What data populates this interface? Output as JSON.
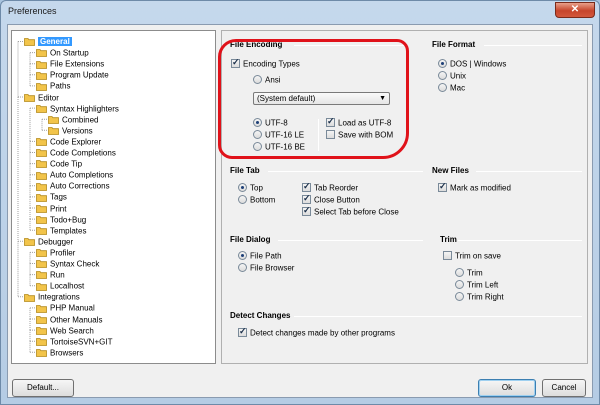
{
  "window": {
    "title": "Preferences",
    "close_glyph": "✕"
  },
  "tree": {
    "items": [
      {
        "label": "General",
        "level": 0,
        "selected": true
      },
      {
        "label": "On Startup",
        "level": 1
      },
      {
        "label": "File Extensions",
        "level": 1
      },
      {
        "label": "Program Update",
        "level": 1
      },
      {
        "label": "Paths",
        "level": 1
      },
      {
        "label": "Editor",
        "level": 0
      },
      {
        "label": "Syntax Highlighters",
        "level": 1
      },
      {
        "label": "Combined",
        "level": 2
      },
      {
        "label": "Versions",
        "level": 2
      },
      {
        "label": "Code Explorer",
        "level": 1
      },
      {
        "label": "Code Completions",
        "level": 1
      },
      {
        "label": "Code Tip",
        "level": 1
      },
      {
        "label": "Auto Completions",
        "level": 1
      },
      {
        "label": "Auto Corrections",
        "level": 1
      },
      {
        "label": "Tags",
        "level": 1
      },
      {
        "label": "Print",
        "level": 1
      },
      {
        "label": "Todo+Bug",
        "level": 1
      },
      {
        "label": "Templates",
        "level": 1
      },
      {
        "label": "Debugger",
        "level": 0
      },
      {
        "label": "Profiler",
        "level": 1
      },
      {
        "label": "Syntax Check",
        "level": 1
      },
      {
        "label": "Run",
        "level": 1
      },
      {
        "label": "Localhost",
        "level": 1
      },
      {
        "label": "Integrations",
        "level": 0
      },
      {
        "label": "PHP Manual",
        "level": 1
      },
      {
        "label": "Other Manuals",
        "level": 1
      },
      {
        "label": "Web Search",
        "level": 1
      },
      {
        "label": "TortoiseSVN+GIT",
        "level": 1
      },
      {
        "label": "Browsers",
        "level": 1
      }
    ]
  },
  "file_encoding": {
    "title": "File Encoding",
    "encoding_types": {
      "label": "Encoding Types",
      "checked": true
    },
    "ansi": {
      "label": "Ansi",
      "checked": false
    },
    "dropdown_value": "(System default)",
    "utf8": {
      "label": "UTF-8",
      "checked": true
    },
    "utf16le": {
      "label": "UTF-16 LE",
      "checked": false
    },
    "utf16be": {
      "label": "UTF-16 BE",
      "checked": false
    },
    "load_as_utf8": {
      "label": "Load as UTF-8",
      "checked": true
    },
    "save_with_bom": {
      "label": "Save with BOM",
      "checked": false
    }
  },
  "file_format": {
    "title": "File Format",
    "dos": {
      "label": "DOS | Windows",
      "checked": true
    },
    "unix": {
      "label": "Unix",
      "checked": false
    },
    "mac": {
      "label": "Mac",
      "checked": false
    }
  },
  "file_tab": {
    "title": "File Tab",
    "top": {
      "label": "Top",
      "checked": true
    },
    "bottom": {
      "label": "Bottom",
      "checked": false
    },
    "tab_reorder": {
      "label": "Tab Reorder",
      "checked": true
    },
    "close_button": {
      "label": "Close Button",
      "checked": true
    },
    "select_tab": {
      "label": "Select Tab before Close",
      "checked": true
    }
  },
  "new_files": {
    "title": "New Files",
    "mark_modified": {
      "label": "Mark as modified",
      "checked": true
    }
  },
  "file_dialog": {
    "title": "File Dialog",
    "file_path": {
      "label": "File Path",
      "checked": true
    },
    "file_browser": {
      "label": "File Browser",
      "checked": false
    }
  },
  "trim": {
    "title": "Trim",
    "trim_on_save": {
      "label": "Trim on save",
      "checked": false
    },
    "trim_opt": {
      "label": "Trim",
      "checked": false
    },
    "trim_left": {
      "label": "Trim Left",
      "checked": false
    },
    "trim_right": {
      "label": "Trim Right",
      "checked": false
    }
  },
  "detect_changes": {
    "title": "Detect Changes",
    "detect": {
      "label": "Detect changes made by other programs",
      "checked": true
    }
  },
  "buttons": {
    "default": "Default...",
    "ok": "Ok",
    "cancel": "Cancel"
  },
  "colors": {
    "selection": "#3399ff",
    "folder": "#f2c44a",
    "highlight_ring": "#e0121a"
  }
}
